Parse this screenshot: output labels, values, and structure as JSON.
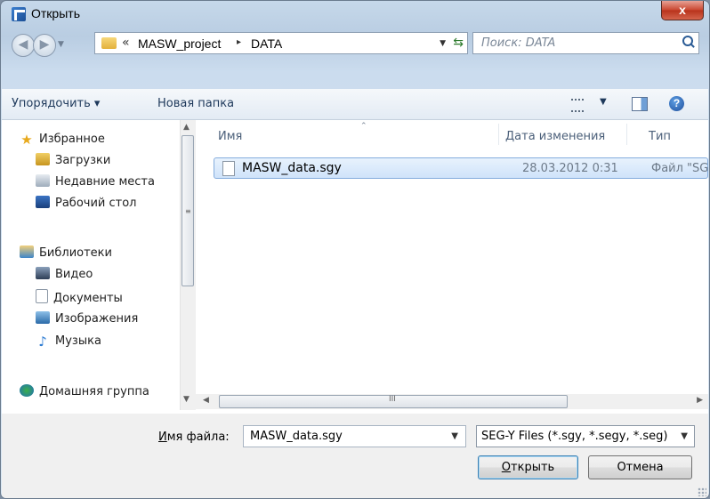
{
  "window": {
    "title": "Открыть",
    "close_label": "x"
  },
  "nav": {
    "back_icon": "arrow-left",
    "forward_icon": "arrow-right"
  },
  "address": {
    "chevron": "«",
    "crumbs": [
      "MASW_project",
      "DATA"
    ],
    "separator": "▸"
  },
  "search": {
    "placeholder": "Поиск: DATA"
  },
  "toolbar": {
    "organize_label": "Упорядочить ▾",
    "new_folder_label": "Новая папка"
  },
  "sidebar": {
    "favorites_label": "Избранное",
    "favorites": [
      "Загрузки",
      "Недавние места",
      "Рабочий стол"
    ],
    "libraries_label": "Библиотеки",
    "libraries": [
      "Видео",
      "Документы",
      "Изображения",
      "Музыка"
    ],
    "homegroup_label": "Домашняя группа"
  },
  "columns": {
    "name": "Имя",
    "date": "Дата изменения",
    "type": "Тип"
  },
  "files": [
    {
      "name": "MASW_data.sgy",
      "date": "28.03.2012 0:31",
      "type": "Файл \"SG"
    }
  ],
  "footer": {
    "filename_label_prefix": "И",
    "filename_label_rest": "мя файла:",
    "filename_value": "MASW_data.sgy",
    "filetype_value": "SEG-Y Files (*.sgy, *.segy, *.seg)",
    "open_label_prefix": "О",
    "open_label_rest": "ткрыть",
    "cancel_label": "Отмена"
  },
  "colors": {
    "accent": "#3c7fb1",
    "selection": "#cfe3fa",
    "close": "#c9452e"
  }
}
